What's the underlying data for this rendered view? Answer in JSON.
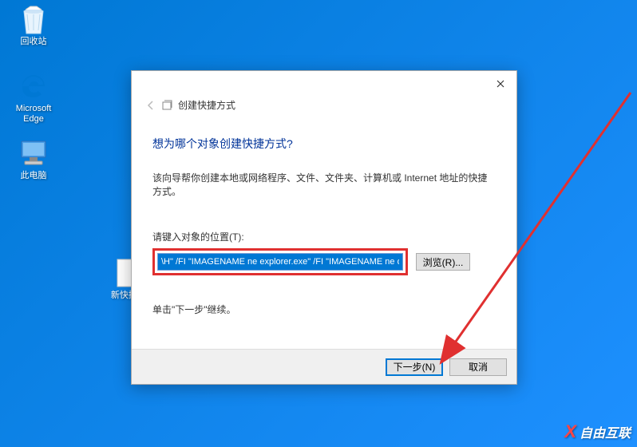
{
  "desktop": {
    "recycle_bin": "回收站",
    "edge": "Microsoft Edge",
    "this_pc": "此电脑",
    "new_shortcut": "新快捷..."
  },
  "dialog": {
    "breadcrumb": "创建快捷方式",
    "headline": "想为哪个对象创建快捷方式?",
    "description": "该向导帮你创建本地或网络程序、文件、文件夹、计算机或 Internet 地址的快捷方式。",
    "field_label": "请键入对象的位置(T):",
    "input_value": "\\H\" /FI \"IMAGENAME ne explorer.exe\" /FI \"IMAGENAME ne dwm.exe",
    "browse": "浏览(R)...",
    "continue_hint": "单击\"下一步\"继续。",
    "next": "下一步(N)",
    "cancel": "取消"
  },
  "watermark": "自由互联"
}
